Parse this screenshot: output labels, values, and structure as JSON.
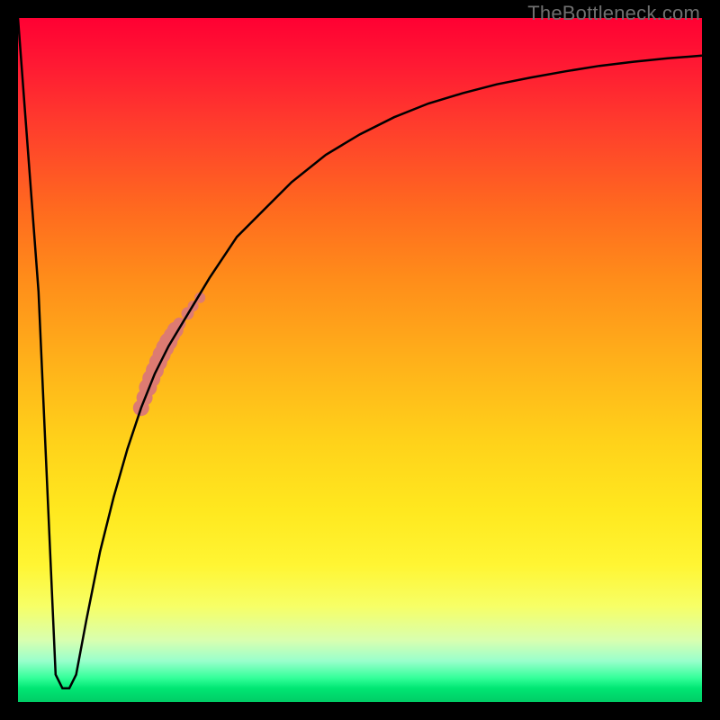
{
  "watermark": "TheBottleneck.com",
  "colors": {
    "curve": "#000000",
    "marker": "#dd7b72",
    "frame": "#000000"
  },
  "chart_data": {
    "type": "line",
    "title": "",
    "xlabel": "",
    "ylabel": "",
    "xlim": [
      0,
      100
    ],
    "ylim": [
      0,
      100
    ],
    "series": [
      {
        "name": "bottleneck-curve",
        "x": [
          0,
          3,
          5.5,
          6.5,
          7.5,
          8.5,
          10,
          12,
          14,
          16,
          18,
          20,
          22,
          25,
          28,
          32,
          36,
          40,
          45,
          50,
          55,
          60,
          65,
          70,
          75,
          80,
          85,
          90,
          95,
          100
        ],
        "y": [
          100,
          60,
          4,
          2,
          2,
          4,
          12,
          22,
          30,
          37,
          43,
          48,
          52,
          57,
          62,
          68,
          72,
          76,
          80,
          83,
          85.5,
          87.5,
          89,
          90.3,
          91.3,
          92.2,
          93,
          93.6,
          94.1,
          94.5
        ]
      }
    ],
    "markers": {
      "name": "highlighted-segment",
      "points_xy": [
        [
          18,
          43
        ],
        [
          18.5,
          44.5
        ],
        [
          19,
          46
        ],
        [
          19.5,
          47.3
        ],
        [
          20,
          48.5
        ],
        [
          20.5,
          49.7
        ],
        [
          21,
          50.8
        ],
        [
          21.5,
          51.8
        ],
        [
          22,
          52.7
        ],
        [
          22.5,
          53.6
        ],
        [
          23,
          54.4
        ],
        [
          23.6,
          55.3
        ],
        [
          24.8,
          56.8
        ],
        [
          25.6,
          57.9
        ],
        [
          26.6,
          59.1
        ]
      ],
      "radii": [
        9,
        9,
        10,
        10,
        10,
        10,
        10,
        10,
        10,
        9,
        9,
        7,
        7,
        6,
        6
      ]
    }
  }
}
